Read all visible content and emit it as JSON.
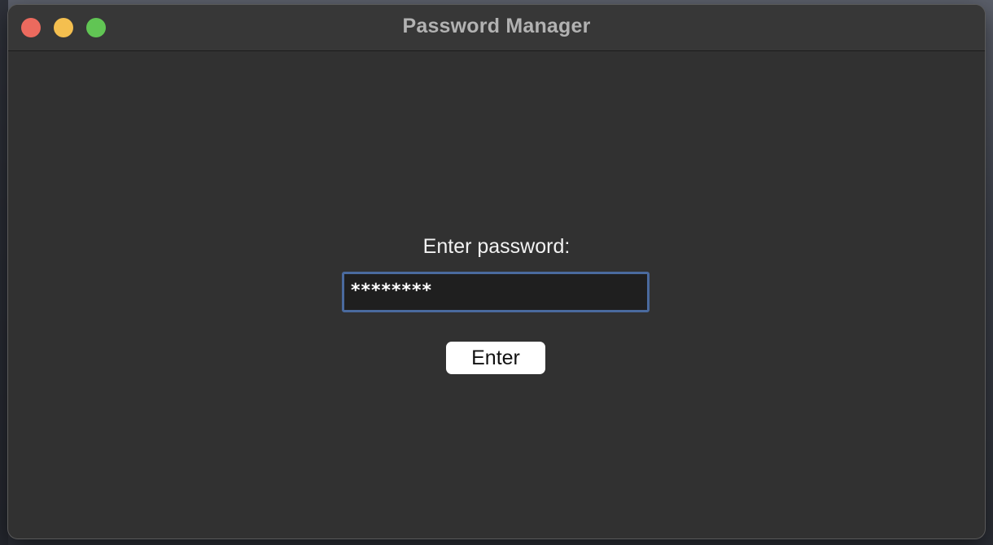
{
  "window": {
    "title": "Password Manager"
  },
  "form": {
    "prompt": "Enter password:",
    "password_masked": "********",
    "enter_label": "Enter"
  },
  "colors": {
    "window_bg": "#313131",
    "titlebar_bg": "#373737",
    "close": "#ec6a5e",
    "minimize": "#f4bf4f",
    "zoom": "#61c554",
    "input_focus_border": "#4a6a9e",
    "button_bg": "#ffffff"
  }
}
